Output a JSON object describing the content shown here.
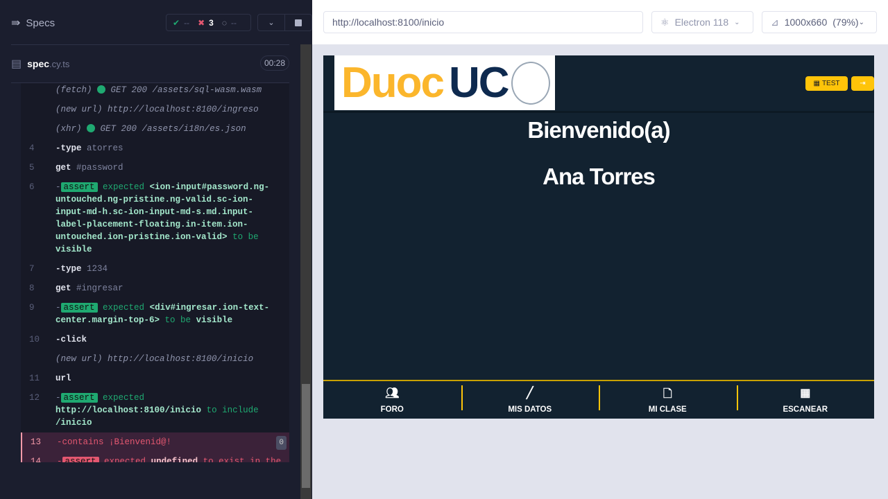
{
  "left": {
    "title": "Specs",
    "passed": "--",
    "failed": "3",
    "pending": "--",
    "spec_name": "spec",
    "spec_ext": ".cy.ts",
    "duration": "00:28"
  },
  "commands": [
    {
      "num": "",
      "parts": [
        [
          "m",
          "(fetch)"
        ],
        [
          "dot",
          ""
        ],
        [
          "m",
          "GET 200 /assets/sql-wasm.wasm"
        ]
      ]
    },
    {
      "num": "",
      "parts": [
        [
          "m",
          "(new url)"
        ],
        [
          "m",
          "http://localhost:8100/ingreso"
        ]
      ]
    },
    {
      "num": "",
      "parts": [
        [
          "m",
          "(xhr)"
        ],
        [
          "dot",
          ""
        ],
        [
          "m",
          "GET 200 /assets/i18n/es.json"
        ]
      ]
    },
    {
      "num": "4",
      "parts": [
        [
          "w",
          "-type"
        ],
        [
          "g",
          "atorres"
        ]
      ]
    },
    {
      "num": "5",
      "parts": [
        [
          "w",
          "get"
        ],
        [
          "g",
          "#password"
        ]
      ]
    },
    {
      "num": "6",
      "parts": [
        [
          "g",
          "-"
        ],
        [
          "badge",
          "assert"
        ],
        [
          "grn",
          "expected"
        ],
        [
          "gb",
          "<ion-input#password.ng-untouched.ng-pristine.ng-valid.sc-ion-input-md-h.sc-ion-input-md-s.md.input-label-placement-floating.in-item.ion-untouched.ion-pristine.ion-valid>"
        ],
        [
          "grn",
          "to be"
        ],
        [
          "gb",
          "visible"
        ]
      ]
    },
    {
      "num": "7",
      "parts": [
        [
          "w",
          "-type"
        ],
        [
          "g",
          "1234"
        ]
      ]
    },
    {
      "num": "8",
      "parts": [
        [
          "w",
          "get"
        ],
        [
          "g",
          "#ingresar"
        ]
      ]
    },
    {
      "num": "9",
      "parts": [
        [
          "g",
          "-"
        ],
        [
          "badge",
          "assert"
        ],
        [
          "grn",
          "expected"
        ],
        [
          "gb",
          "<div#ingresar.ion-text-center.margin-top-6>"
        ],
        [
          "grn",
          "to be"
        ],
        [
          "gb",
          "visible"
        ]
      ]
    },
    {
      "num": "10",
      "parts": [
        [
          "w",
          "-click"
        ]
      ]
    },
    {
      "num": "",
      "parts": [
        [
          "m",
          "(new url)"
        ],
        [
          "m",
          "http://localhost:8100/inicio"
        ]
      ]
    },
    {
      "num": "11",
      "parts": [
        [
          "w",
          "url"
        ]
      ]
    },
    {
      "num": "12",
      "parts": [
        [
          "g",
          "-"
        ],
        [
          "badge",
          "assert"
        ],
        [
          "grn",
          "expected"
        ],
        [
          "gb",
          "http://localhost:8100/inicio"
        ],
        [
          "grn",
          "to include"
        ],
        [
          "gb",
          "/inicio"
        ]
      ]
    },
    {
      "num": "13",
      "fail": true,
      "count": "0",
      "parts": [
        [
          "red",
          "-contains"
        ],
        [
          "red",
          "¡Bienvenid@!"
        ]
      ]
    },
    {
      "num": "14",
      "fail": true,
      "parts": [
        [
          "red",
          "-"
        ],
        [
          "rbadge",
          "assert"
        ],
        [
          "red",
          "expected"
        ],
        [
          "rb",
          "undefined"
        ],
        [
          "red",
          "to exist in the DOM"
        ]
      ]
    }
  ],
  "browser": {
    "url": "http://localhost:8100/inicio",
    "browser": "Electron 118",
    "viewport": "1000x660",
    "zoom": "(79%)"
  },
  "app": {
    "logo_duoc": "Duoc",
    "logo_uc": "UC",
    "test_button": "TEST",
    "welcome": "Bienvenido(a)",
    "user_name": "Ana Torres",
    "tabs": [
      {
        "label": "FORO",
        "icon": "people-icon"
      },
      {
        "label": "MIS DATOS",
        "icon": "pencil-icon"
      },
      {
        "label": "MI CLASE",
        "icon": "document-icon"
      },
      {
        "label": "ESCANEAR",
        "icon": "qr-code-icon"
      }
    ]
  },
  "colors": {
    "accent": "#ffc409",
    "pass": "#1fa971",
    "fail": "#e45770"
  }
}
